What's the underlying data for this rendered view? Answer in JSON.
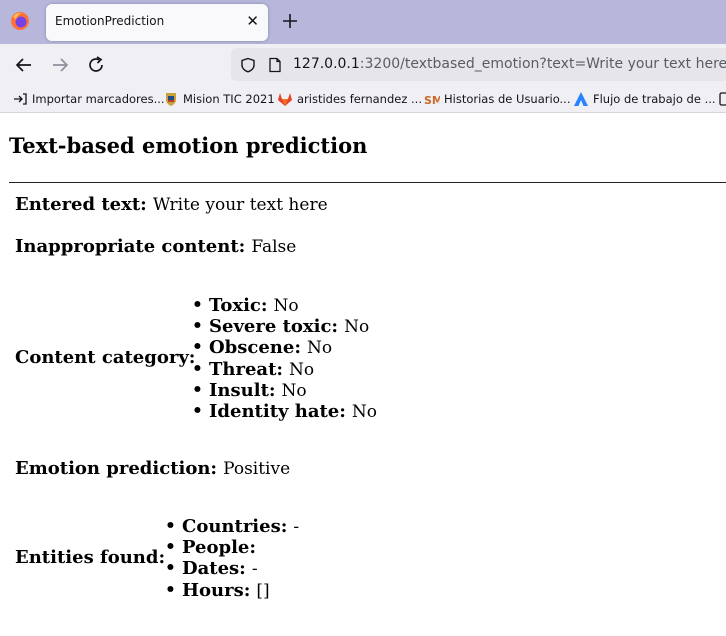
{
  "browser": {
    "tab": {
      "title": "EmotionPrediction",
      "close_label": "✕"
    },
    "address": {
      "host": "127.0.0.1",
      "rest": ":3200/textbased_emotion?text=Write your text here"
    },
    "bookmarks": [
      {
        "label": "Importar marcadores...",
        "icon": "import-icon"
      },
      {
        "label": "Mision TIC 2021",
        "icon": "crest-icon"
      },
      {
        "label": "aristides fernandez ...",
        "icon": "gitlab-icon"
      },
      {
        "label": "Historias de Usuario...",
        "icon": "sm-icon"
      },
      {
        "label": "Flujo de trabajo de ...",
        "icon": "atlassian-icon"
      }
    ]
  },
  "page": {
    "title": "Text-based emotion prediction",
    "entered_text": {
      "label": "Entered text:",
      "value": "Write your text here"
    },
    "inappropriate": {
      "label": "Inappropriate content:",
      "value": "False"
    },
    "content_category": {
      "label": "Content category:",
      "items": [
        {
          "label": "Toxic:",
          "value": "No"
        },
        {
          "label": "Severe toxic:",
          "value": "No"
        },
        {
          "label": "Obscene:",
          "value": "No"
        },
        {
          "label": "Threat:",
          "value": "No"
        },
        {
          "label": "Insult:",
          "value": "No"
        },
        {
          "label": "Identity hate:",
          "value": "No"
        }
      ]
    },
    "emotion": {
      "label": "Emotion prediction:",
      "value": "Positive"
    },
    "entities": {
      "label": "Entities found:",
      "items": [
        {
          "label": "Countries:",
          "value": "-"
        },
        {
          "label": "People:",
          "value": ""
        },
        {
          "label": "Dates:",
          "value": "-"
        },
        {
          "label": "Hours:",
          "value": "[]"
        }
      ]
    }
  }
}
